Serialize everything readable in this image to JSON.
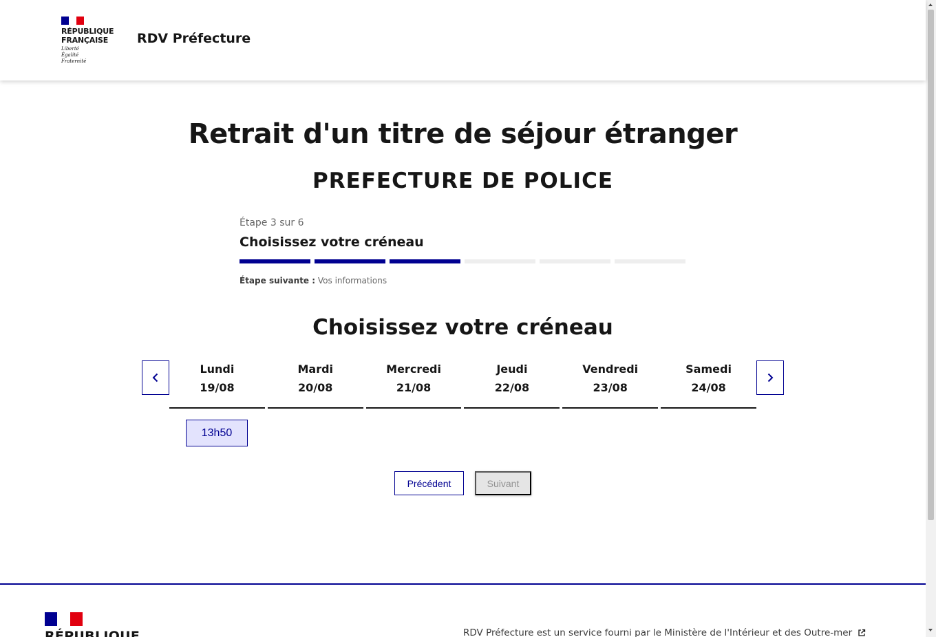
{
  "header": {
    "republic_line1": "RÉPUBLIQUE",
    "republic_line2": "FRANÇAISE",
    "motto_1": "Liberté",
    "motto_2": "Égalité",
    "motto_3": "Fraternité",
    "service_name": "RDV Préfecture"
  },
  "main": {
    "title": "Retrait d'un titre de séjour étranger",
    "subtitle": "PREFECTURE DE POLICE"
  },
  "stepper": {
    "state": "Étape 3 sur 6",
    "title": "Choisissez votre créneau",
    "current_step": 3,
    "total_steps": 6,
    "next_label": "Étape suivante :",
    "next_value": "Vos informations"
  },
  "calendar": {
    "section_title": "Choisissez votre créneau",
    "days": [
      {
        "name": "Lundi",
        "date": "19/08"
      },
      {
        "name": "Mardi",
        "date": "20/08"
      },
      {
        "name": "Mercredi",
        "date": "21/08"
      },
      {
        "name": "Jeudi",
        "date": "22/08"
      },
      {
        "name": "Vendredi",
        "date": "23/08"
      },
      {
        "name": "Samedi",
        "date": "24/08"
      }
    ],
    "slot": "13h50"
  },
  "actions": {
    "previous": "Précédent",
    "next": "Suivant"
  },
  "footer": {
    "republic": "RÉPUBLIQUE",
    "service_text": "RDV Préfecture est un service fourni par le Ministère de l'Intérieur et des Outre-mer"
  },
  "colors": {
    "brand_blue": "#000091",
    "marianne_red": "#e1000f",
    "slot_bg": "#e3e3fd"
  }
}
